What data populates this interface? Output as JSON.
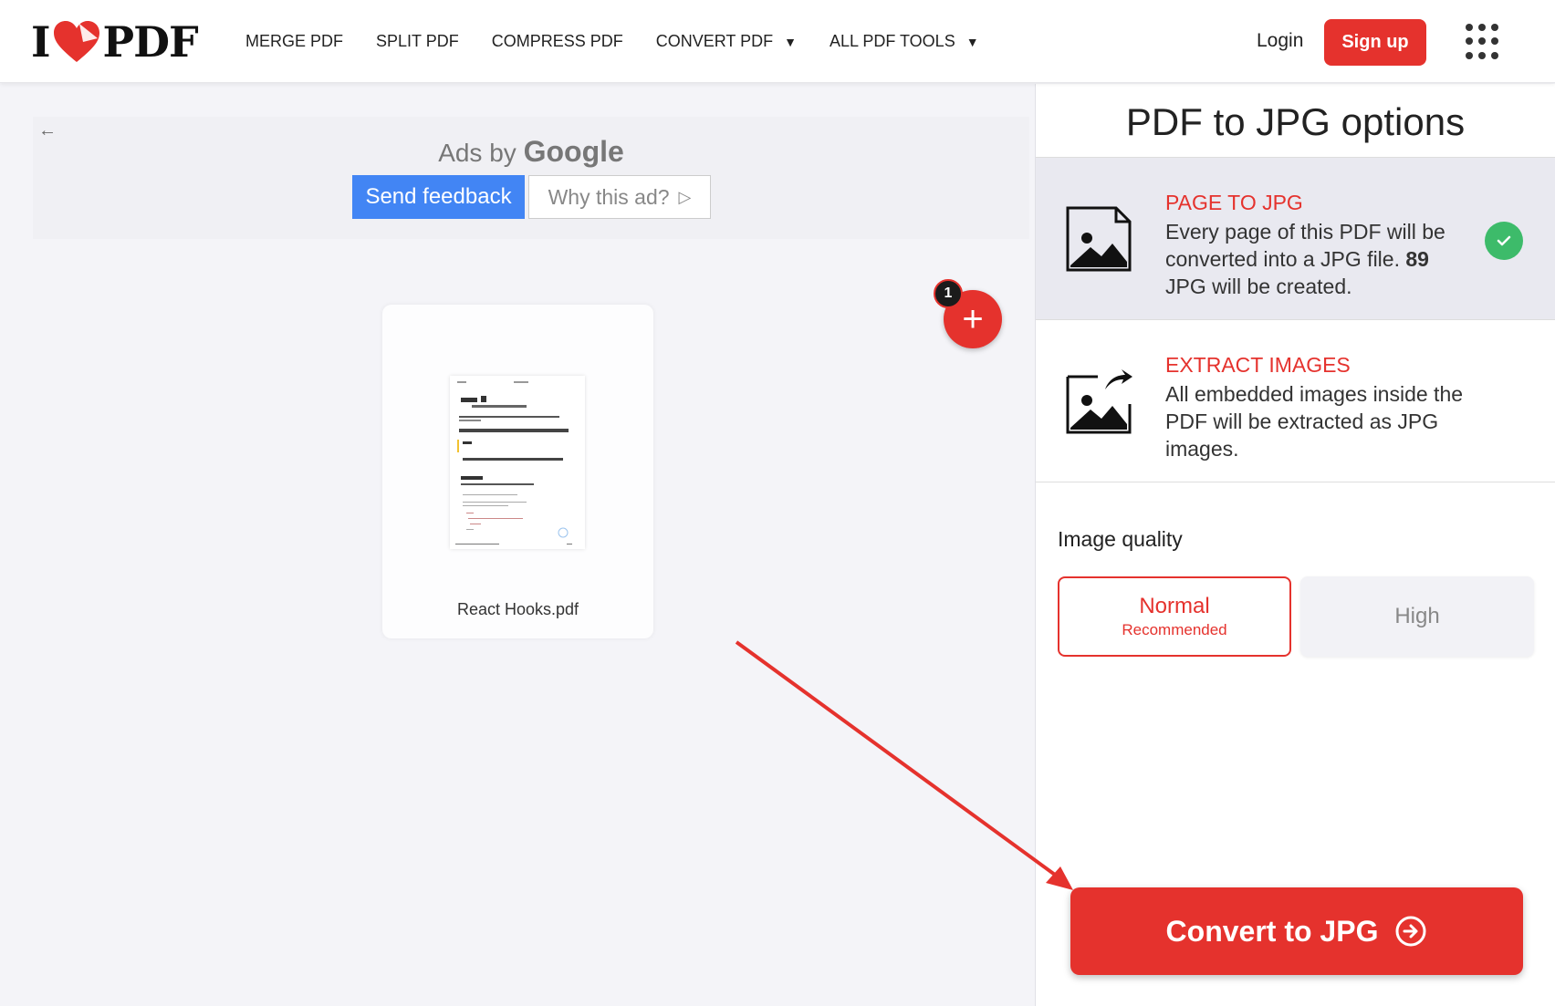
{
  "header": {
    "logo_left": "I",
    "logo_right": "PDF",
    "nav": [
      {
        "label": "MERGE PDF",
        "dropdown": false
      },
      {
        "label": "SPLIT PDF",
        "dropdown": false
      },
      {
        "label": "COMPRESS PDF",
        "dropdown": false
      },
      {
        "label": "CONVERT PDF",
        "dropdown": true
      },
      {
        "label": "ALL PDF TOOLS",
        "dropdown": true
      }
    ],
    "login": "Login",
    "signup": "Sign up"
  },
  "ad": {
    "ads_by": "Ads by",
    "google": "Google",
    "send_feedback": "Send feedback",
    "why_ad": "Why this ad?"
  },
  "file": {
    "name": "React Hooks.pdf",
    "count_badge": "1"
  },
  "sidebar": {
    "title": "PDF to JPG options",
    "options": [
      {
        "name": "PAGE TO JPG",
        "desc_before": "Every page of this PDF will be converted into a JPG file.",
        "desc_count": "89",
        "desc_after": "JPG will be created.",
        "selected": true
      },
      {
        "name": "EXTRACT IMAGES",
        "desc": "All embedded images inside the PDF will be extracted as JPG images.",
        "selected": false
      }
    ],
    "image_quality": {
      "title": "Image quality",
      "normal": "Normal",
      "normal_sub": "Recommended",
      "high": "High",
      "selected": "Normal"
    },
    "convert_label": "Convert to JPG"
  },
  "colors": {
    "brand_red": "#e5322d",
    "check_green": "#3dbb6a",
    "google_blue": "#4285f4"
  }
}
